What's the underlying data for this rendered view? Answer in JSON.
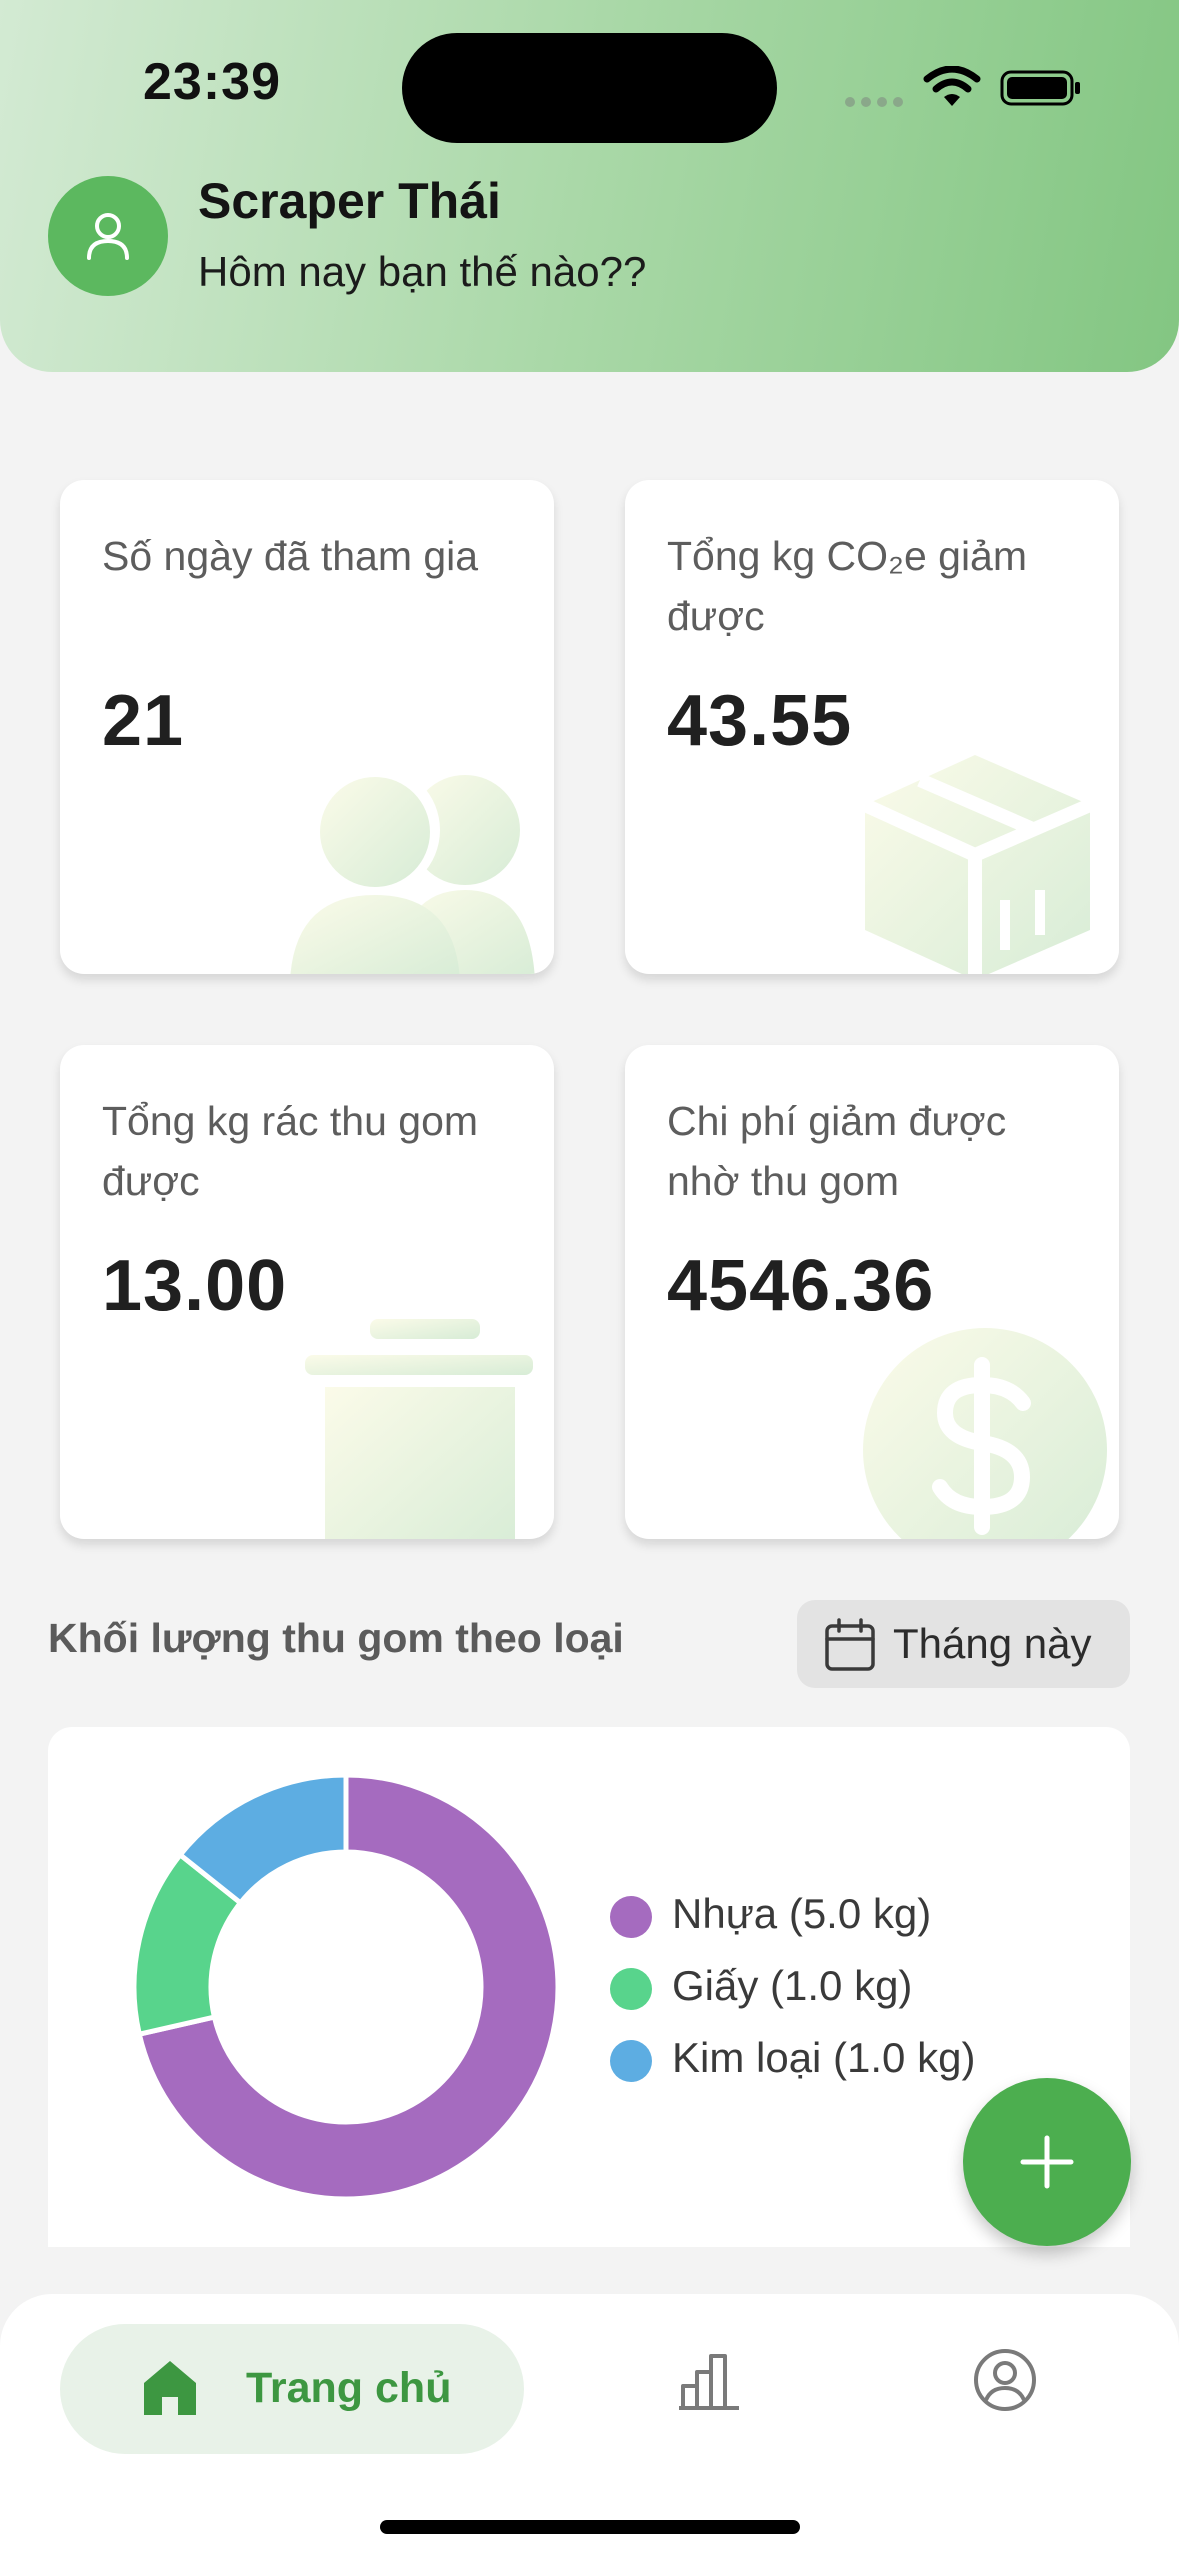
{
  "status_bar": {
    "time": "23:39"
  },
  "header": {
    "user_name": "Scraper Thái",
    "greeting": "Hôm nay bạn thế nào??"
  },
  "stats": [
    {
      "label": "Số ngày đã tham gia",
      "value": "21",
      "icon": "users-icon"
    },
    {
      "label": "Tổng kg CO₂e giảm được",
      "value": "43.55",
      "icon": "box-icon"
    },
    {
      "label": "Tổng kg rác thu gom được",
      "value": "13.00",
      "icon": "trash-can-icon"
    },
    {
      "label": "Chi phí giảm được nhờ thu gom",
      "value": "4546.36",
      "icon": "dollar-icon"
    }
  ],
  "collection_section": {
    "title": "Khối lượng thu gom theo loại",
    "period": "Tháng này"
  },
  "chart_data": {
    "type": "pie",
    "categories": [
      "Nhựa",
      "Giấy",
      "Kim loại"
    ],
    "values": [
      5.0,
      1.0,
      1.0
    ],
    "legend": [
      "Nhựa (5.0 kg)",
      "Giấy (1.0 kg)",
      "Kim loại (1.0 kg)"
    ],
    "colors": [
      "#a56bbf",
      "#58d48c",
      "#5dade2"
    ],
    "legend_position": "right"
  },
  "nav": {
    "home_label": "Trang chủ"
  },
  "colors": {
    "primary": "#4cae4f",
    "header_start": "#d3ead3",
    "header_end": "#83c682"
  }
}
